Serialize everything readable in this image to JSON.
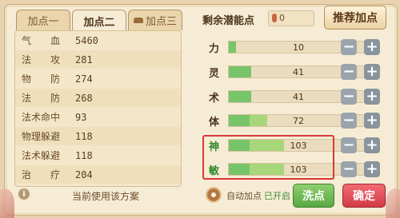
{
  "tabs": [
    {
      "label": "加点一",
      "active": false
    },
    {
      "label": "加点二",
      "active": true
    },
    {
      "label": "加点三",
      "active": false
    }
  ],
  "stats": [
    {
      "name": "气　　血",
      "value": "5460"
    },
    {
      "name": "法　　攻",
      "value": "281"
    },
    {
      "name": "物　　防",
      "value": "274"
    },
    {
      "name": "法　　防",
      "value": "268"
    },
    {
      "name": "法术命中",
      "value": "93"
    },
    {
      "name": "物理躲避",
      "value": "118"
    },
    {
      "name": "法术躲避",
      "value": "118"
    },
    {
      "name": "治　　疗",
      "value": "204"
    }
  ],
  "footer_left": {
    "plan_text": "当前使用该方案"
  },
  "remaining": {
    "label": "剩余潜能点",
    "value": "0"
  },
  "recommend_button": "推荐加点",
  "attributes": [
    {
      "name": "力",
      "value": "10",
      "fill": 0.05,
      "fill2": 0.0
    },
    {
      "name": "灵",
      "value": "41",
      "fill": 0.16,
      "fill2": 0.0
    },
    {
      "name": "术",
      "value": "41",
      "fill": 0.16,
      "fill2": 0.0
    },
    {
      "name": "体",
      "value": "72",
      "fill": 0.15,
      "fill2": 0.13
    },
    {
      "name": "神",
      "value": "103",
      "fill": 0.15,
      "fill2": 0.25
    },
    {
      "name": "敏",
      "value": "103",
      "fill": 0.15,
      "fill2": 0.25
    }
  ],
  "buttons": {
    "minus": "−",
    "plus": "+"
  },
  "auto": {
    "label": "自动加点",
    "status": "已开启"
  },
  "wash_button": "洗点",
  "confirm_button": "确定",
  "colors": {
    "bar_primary": "#78c46a",
    "bar_secondary": "#a8d77b",
    "confirm": "#d13b46",
    "wash": "#58a843"
  }
}
